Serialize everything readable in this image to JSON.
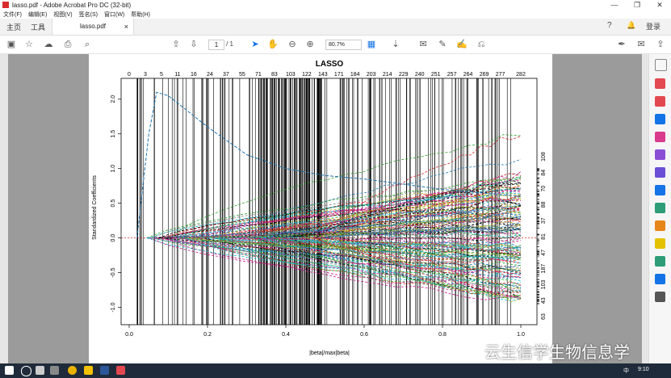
{
  "window": {
    "title": "lasso.pdf - Adobe Acrobat Pro DC (32-bit)",
    "minimize": "—",
    "restore": "❐",
    "close": "✕"
  },
  "menu": [
    "文件(F)",
    "编辑(E)",
    "视图(V)",
    "签名(S)",
    "窗口(W)",
    "帮助(H)"
  ],
  "tabs": {
    "home": "主页",
    "tools": "工具",
    "doc": "lasso.pdf",
    "close": "×",
    "help": "?",
    "bell": "🔔",
    "login": "登录"
  },
  "toolbar": {
    "page_current": "1",
    "page_total": "/ 1",
    "zoom": "80.7%"
  },
  "chart_data": {
    "type": "line",
    "title": "LASSO",
    "xlabel": "|beta|/max|beta|",
    "ylabel": "Standardized Coefficients",
    "xlim": [
      0.0,
      1.0
    ],
    "ylim": [
      -1.25,
      2.3
    ],
    "x_ticks": [
      "0.0",
      "0.2",
      "0.4",
      "0.6",
      "0.8",
      "1.0"
    ],
    "y_ticks": [
      "2.0",
      "1.5",
      "1.0",
      "0.5",
      "0.0",
      "-0.5",
      "-1.0"
    ],
    "top_ticks": [
      "0",
      "3",
      "5",
      "11",
      "16",
      "24",
      "37",
      "55",
      "71",
      "83",
      "103",
      "122",
      "143",
      "171",
      "184",
      "203",
      "214",
      "229",
      "240",
      "251",
      "257",
      "264",
      "269",
      "277",
      "282"
    ],
    "right_labels": [
      "108",
      "84",
      "70",
      "88",
      "37",
      "81",
      "47",
      "187",
      "103",
      "43",
      "63"
    ],
    "series_colors": [
      "#000000",
      "#d62728",
      "#2ca02c",
      "#1f77b4",
      "#17becf",
      "#c71585",
      "#bcbd22",
      "#7f7f7f"
    ]
  },
  "taskbar": {
    "time": "9:10",
    "ime": "中"
  },
  "watermark": "云生信学生物信息学"
}
